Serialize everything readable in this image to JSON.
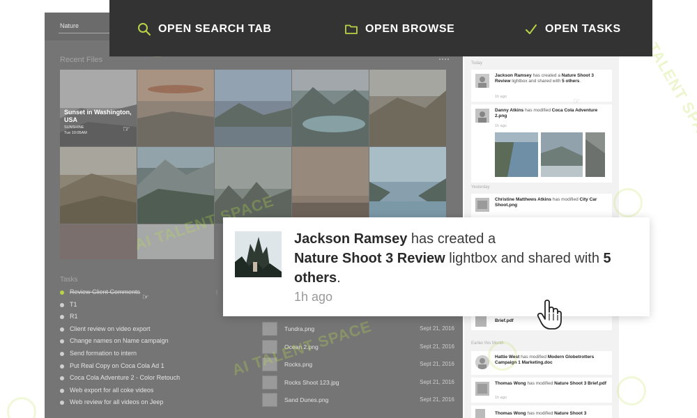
{
  "header": {
    "actions": [
      {
        "icon": "search-icon",
        "label": "OPEN SEARCH TAB"
      },
      {
        "icon": "folder-icon",
        "label": "OPEN BROWSE"
      },
      {
        "icon": "check-icon",
        "label": "OPEN TASKS"
      }
    ],
    "accent": "#b9d347",
    "bar_color": "#333333"
  },
  "left_panel": {
    "search_value": "Nature",
    "recent_files_label": "Recent Files",
    "featured_tile": {
      "title": "Sunset in Washington, USA",
      "line2": "SUNSHINE",
      "line3": "Tue 10:05AM"
    },
    "tasks_heading": "Tasks",
    "tasks": [
      {
        "label": "Review Client Comments",
        "done": true
      },
      {
        "label": "T1",
        "done": false
      },
      {
        "label": "R1",
        "done": false
      },
      {
        "label": "Client review on video export",
        "done": false
      },
      {
        "label": "Change names on Name campaign",
        "done": false
      },
      {
        "label": "Send formation to intern",
        "done": false
      },
      {
        "label": "Put Real Copy on Coca Cola Ad 1",
        "done": false
      },
      {
        "label": "Coca Cola Adventure 2 - Color Retouch",
        "done": false
      },
      {
        "label": "Web export for all coke videos",
        "done": false
      },
      {
        "label": "Web review for all videos on Jeep",
        "done": false
      }
    ],
    "files": [
      {
        "name": "Tundra.png",
        "date": "Sept 21, 2016"
      },
      {
        "name": "Ocean 2.png",
        "date": "Sept 21, 2016"
      },
      {
        "name": "Rocks.png",
        "date": "Sept 21, 2016"
      },
      {
        "name": "Rocks Shoot 123.jpg",
        "date": "Sept 21, 2016"
      },
      {
        "name": "Sand Dunes.png",
        "date": "Sept 21, 2016"
      }
    ]
  },
  "right_panel": {
    "groups": {
      "today": "Today",
      "yesterday": "Yesterday",
      "earlier": "Earlier this Month"
    },
    "activities": [
      {
        "user": "Jackson Ramsey",
        "action": " has created a ",
        "object": "Nature Shoot 3 Review",
        "rest": " lightbox and shared with ",
        "count": "5 others",
        "tail": ".",
        "time": "1h ago"
      },
      {
        "user": "Danny Atkins",
        "action": " has modified ",
        "object": "Coca Cola Adventure 2.png",
        "time": "1h ago"
      },
      {
        "user": "Christine Matthews Atkins",
        "action": " has modified ",
        "object": "City Car Shoot.png",
        "time": ""
      },
      {
        "user": "",
        "action": "",
        "object": "Brief.pdf",
        "time": ""
      },
      {
        "user": "Hattie West",
        "action": " has modified ",
        "object": "Modern Globetrotters Campaign 1 Marketing.doc",
        "time": ""
      },
      {
        "user": "Thomas Wong",
        "action": " has modified ",
        "object": "Nature Shoot 3 Brief.pdf",
        "time": "1h ago"
      },
      {
        "user": "Thomas Wong",
        "action": " has modified ",
        "object": "Nature Shoot 3",
        "time": ""
      }
    ]
  },
  "notification": {
    "user": "Jackson Ramsey",
    "action": " has created a",
    "object": "Nature Shoot 3 Review",
    "middle": " lightbox and shared with ",
    "count": "5 others",
    "tail": ".",
    "time": "1h ago"
  },
  "watermark": {
    "text": "AI TALENT SPACE",
    "color": "#bce04a"
  }
}
